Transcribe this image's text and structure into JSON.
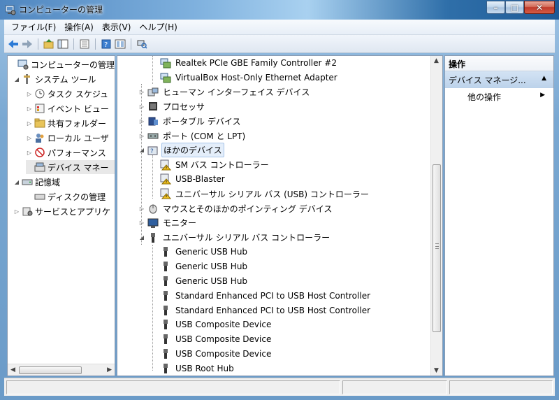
{
  "window": {
    "title": "コンピューターの管理",
    "buttons": {
      "minimize": "–",
      "maximize": "□",
      "close": "✕"
    }
  },
  "menu": [
    "ファイル(F)",
    "操作(A)",
    "表示(V)",
    "ヘルプ(H)"
  ],
  "toolbar": {
    "icons": [
      "back-arrow-icon",
      "forward-arrow-icon",
      "up-folder-icon",
      "console-tree-icon",
      "properties-icon",
      "help-icon",
      "view-icon",
      "scan-hardware-icon"
    ]
  },
  "left_tree": {
    "items": [
      {
        "label": "コンピューターの管理 (",
        "indent": 0,
        "expander": ""
      },
      {
        "label": "システム ツール",
        "indent": 1,
        "expander": "◢"
      },
      {
        "label": "タスク スケジュ",
        "indent": 2,
        "expander": "▷"
      },
      {
        "label": "イベント ビュー",
        "indent": 2,
        "expander": "▷"
      },
      {
        "label": "共有フォルダー",
        "indent": 2,
        "expander": "▷"
      },
      {
        "label": "ローカル ユーザ",
        "indent": 2,
        "expander": "▷"
      },
      {
        "label": "パフォーマンス",
        "indent": 2,
        "expander": "▷"
      },
      {
        "label": "デバイス マネー",
        "indent": 2,
        "expander": ""
      },
      {
        "label": "記憶域",
        "indent": 1,
        "expander": "◢"
      },
      {
        "label": "ディスクの管理",
        "indent": 2,
        "expander": ""
      },
      {
        "label": "サービスとアプリケ",
        "indent": 1,
        "expander": "▷"
      }
    ]
  },
  "device_tree": {
    "items": [
      {
        "label": "Realtek PCIe GBE Family Controller #2",
        "level": 2,
        "expander": "",
        "icon": "network-adapter-icon"
      },
      {
        "label": "VirtualBox Host-Only Ethernet Adapter",
        "level": 2,
        "expander": "",
        "icon": "network-adapter-icon"
      },
      {
        "label": "ヒューマン インターフェイス デバイス",
        "level": 1,
        "expander": "▷",
        "icon": "hid-icon"
      },
      {
        "label": "プロセッサ",
        "level": 1,
        "expander": "▷",
        "icon": "processor-icon"
      },
      {
        "label": "ポータブル デバイス",
        "level": 1,
        "expander": "▷",
        "icon": "portable-device-icon"
      },
      {
        "label": "ポート (COM と LPT)",
        "level": 1,
        "expander": "▷",
        "icon": "port-icon"
      },
      {
        "label": "ほかのデバイス",
        "level": 1,
        "expander": "◢",
        "icon": "unknown-device-icon",
        "selected": true
      },
      {
        "label": "SM バス コントローラー",
        "level": 2,
        "expander": "",
        "icon": "warning-device-icon"
      },
      {
        "label": "USB-Blaster",
        "level": 2,
        "expander": "",
        "icon": "warning-device-icon"
      },
      {
        "label": "ユニバーサル シリアル バス (USB) コントローラー",
        "level": 2,
        "expander": "",
        "icon": "warning-device-icon"
      },
      {
        "label": "マウスとそのほかのポインティング デバイス",
        "level": 1,
        "expander": "▷",
        "icon": "mouse-icon"
      },
      {
        "label": "モニター",
        "level": 1,
        "expander": "▷",
        "icon": "monitor-icon"
      },
      {
        "label": "ユニバーサル シリアル バス コントローラー",
        "level": 1,
        "expander": "◢",
        "icon": "usb-icon"
      },
      {
        "label": "Generic USB Hub",
        "level": 2,
        "expander": "",
        "icon": "usb-icon"
      },
      {
        "label": "Generic USB Hub",
        "level": 2,
        "expander": "",
        "icon": "usb-icon"
      },
      {
        "label": "Generic USB Hub",
        "level": 2,
        "expander": "",
        "icon": "usb-icon"
      },
      {
        "label": "Standard Enhanced PCI to USB Host Controller",
        "level": 2,
        "expander": "",
        "icon": "usb-icon"
      },
      {
        "label": "Standard Enhanced PCI to USB Host Controller",
        "level": 2,
        "expander": "",
        "icon": "usb-icon"
      },
      {
        "label": "USB Composite Device",
        "level": 2,
        "expander": "",
        "icon": "usb-icon"
      },
      {
        "label": "USB Composite Device",
        "level": 2,
        "expander": "",
        "icon": "usb-icon"
      },
      {
        "label": "USB Composite Device",
        "level": 2,
        "expander": "",
        "icon": "usb-icon"
      },
      {
        "label": "USB Root Hub",
        "level": 2,
        "expander": "",
        "icon": "usb-icon"
      }
    ]
  },
  "actions": {
    "header": "操作",
    "section": "デバイス マネージ...",
    "item": "他の操作"
  }
}
